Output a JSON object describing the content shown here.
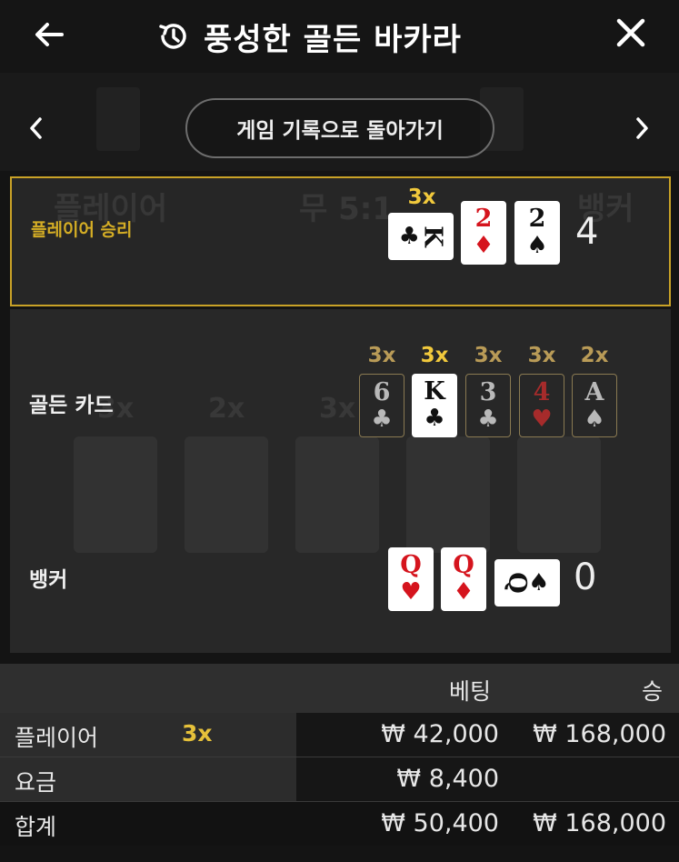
{
  "header": {
    "title": "풍성한 골든 바카라"
  },
  "nav": {
    "back_to_history": "게임 기록으로 돌아가기"
  },
  "rows": {
    "player": {
      "label": "플레이어 승리",
      "multiplier": "3x",
      "cards": [
        {
          "rank": "K",
          "suit": "♣",
          "color": "black",
          "orientation": "side"
        },
        {
          "rank": "2",
          "suit": "♦",
          "color": "red",
          "orientation": "up"
        },
        {
          "rank": "2",
          "suit": "♠",
          "color": "black",
          "orientation": "up"
        }
      ],
      "score": "4"
    },
    "golden": {
      "label": "골든 카드",
      "cards": [
        {
          "mult": "3x",
          "rank": "6",
          "suit": "♣",
          "color": "black",
          "highlighted": false
        },
        {
          "mult": "3x",
          "rank": "K",
          "suit": "♣",
          "color": "black",
          "highlighted": true
        },
        {
          "mult": "3x",
          "rank": "3",
          "suit": "♣",
          "color": "black",
          "highlighted": false
        },
        {
          "mult": "3x",
          "rank": "4",
          "suit": "♥",
          "color": "red",
          "highlighted": false
        },
        {
          "mult": "2x",
          "rank": "A",
          "suit": "♠",
          "color": "black",
          "highlighted": false
        }
      ]
    },
    "banker": {
      "label": "뱅커",
      "cards": [
        {
          "rank": "Q",
          "suit": "♥",
          "color": "red",
          "orientation": "up"
        },
        {
          "rank": "Q",
          "suit": "♦",
          "color": "red",
          "orientation": "up"
        },
        {
          "rank": "Q",
          "suit": "♠",
          "color": "black",
          "orientation": "side"
        }
      ],
      "score": "0"
    }
  },
  "background_ghost": {
    "player": "플레이어",
    "tie": "무 5:1",
    "banker": "뱅커",
    "mults": [
      "3x",
      "2x",
      "3x"
    ]
  },
  "table": {
    "headers": {
      "bet": "베팅",
      "win": "승"
    },
    "rows": [
      {
        "label": "플레이어",
        "mult": "3x",
        "bet": "₩ 42,000",
        "win": "₩ 168,000"
      },
      {
        "label": "요금",
        "mult": "",
        "bet": "₩ 8,400",
        "win": ""
      },
      {
        "label": "합계",
        "mult": "",
        "bet": "₩ 50,400",
        "win": "₩ 168,000"
      }
    ]
  },
  "colors": {
    "accent_gold": "#c9a227",
    "suit_red": "#d5141d",
    "background": "#141414"
  },
  "icons": [
    "back-arrow-icon",
    "history-icon",
    "close-icon",
    "chevron-left-icon",
    "chevron-right-icon"
  ]
}
